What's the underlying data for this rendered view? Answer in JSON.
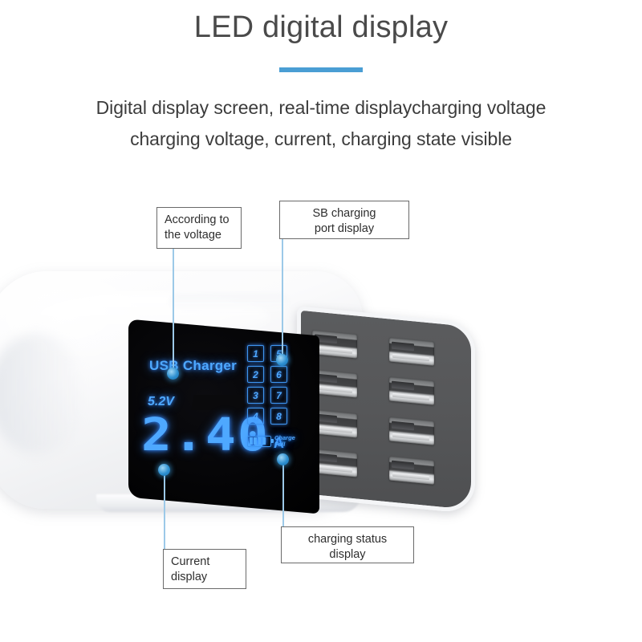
{
  "header": {
    "title": "LED digital display",
    "accent_color": "#4a9ed4",
    "subtitle_line1": "Digital display screen, real-time displaycharging voltage",
    "subtitle_line2": "charging voltage, current, charging state visible"
  },
  "callouts": [
    {
      "id": "voltage",
      "label": "According to\nthe voltage",
      "align": "left"
    },
    {
      "id": "usb_port",
      "label": "SB charging\nport display",
      "align": "center"
    },
    {
      "id": "current",
      "label": "Current\ndisplay",
      "align": "left"
    },
    {
      "id": "charge_status",
      "label": "charging status\ndisplay",
      "align": "center"
    }
  ],
  "device": {
    "body_color": "#f5f6f8",
    "usb_panel_color": "#56575a",
    "screen_color": "#050507",
    "led_color": "#4ea8ff",
    "usb_port_count": 8
  },
  "led_display": {
    "title": "USB Charger",
    "voltage": "5.2V",
    "current": "2.40",
    "current_unit": "A",
    "port_numbers": [
      "1",
      "2",
      "3",
      "4",
      "5",
      "6",
      "7",
      "8"
    ],
    "charge_status_line1": "Charge",
    "charge_status_line2": "Full"
  }
}
